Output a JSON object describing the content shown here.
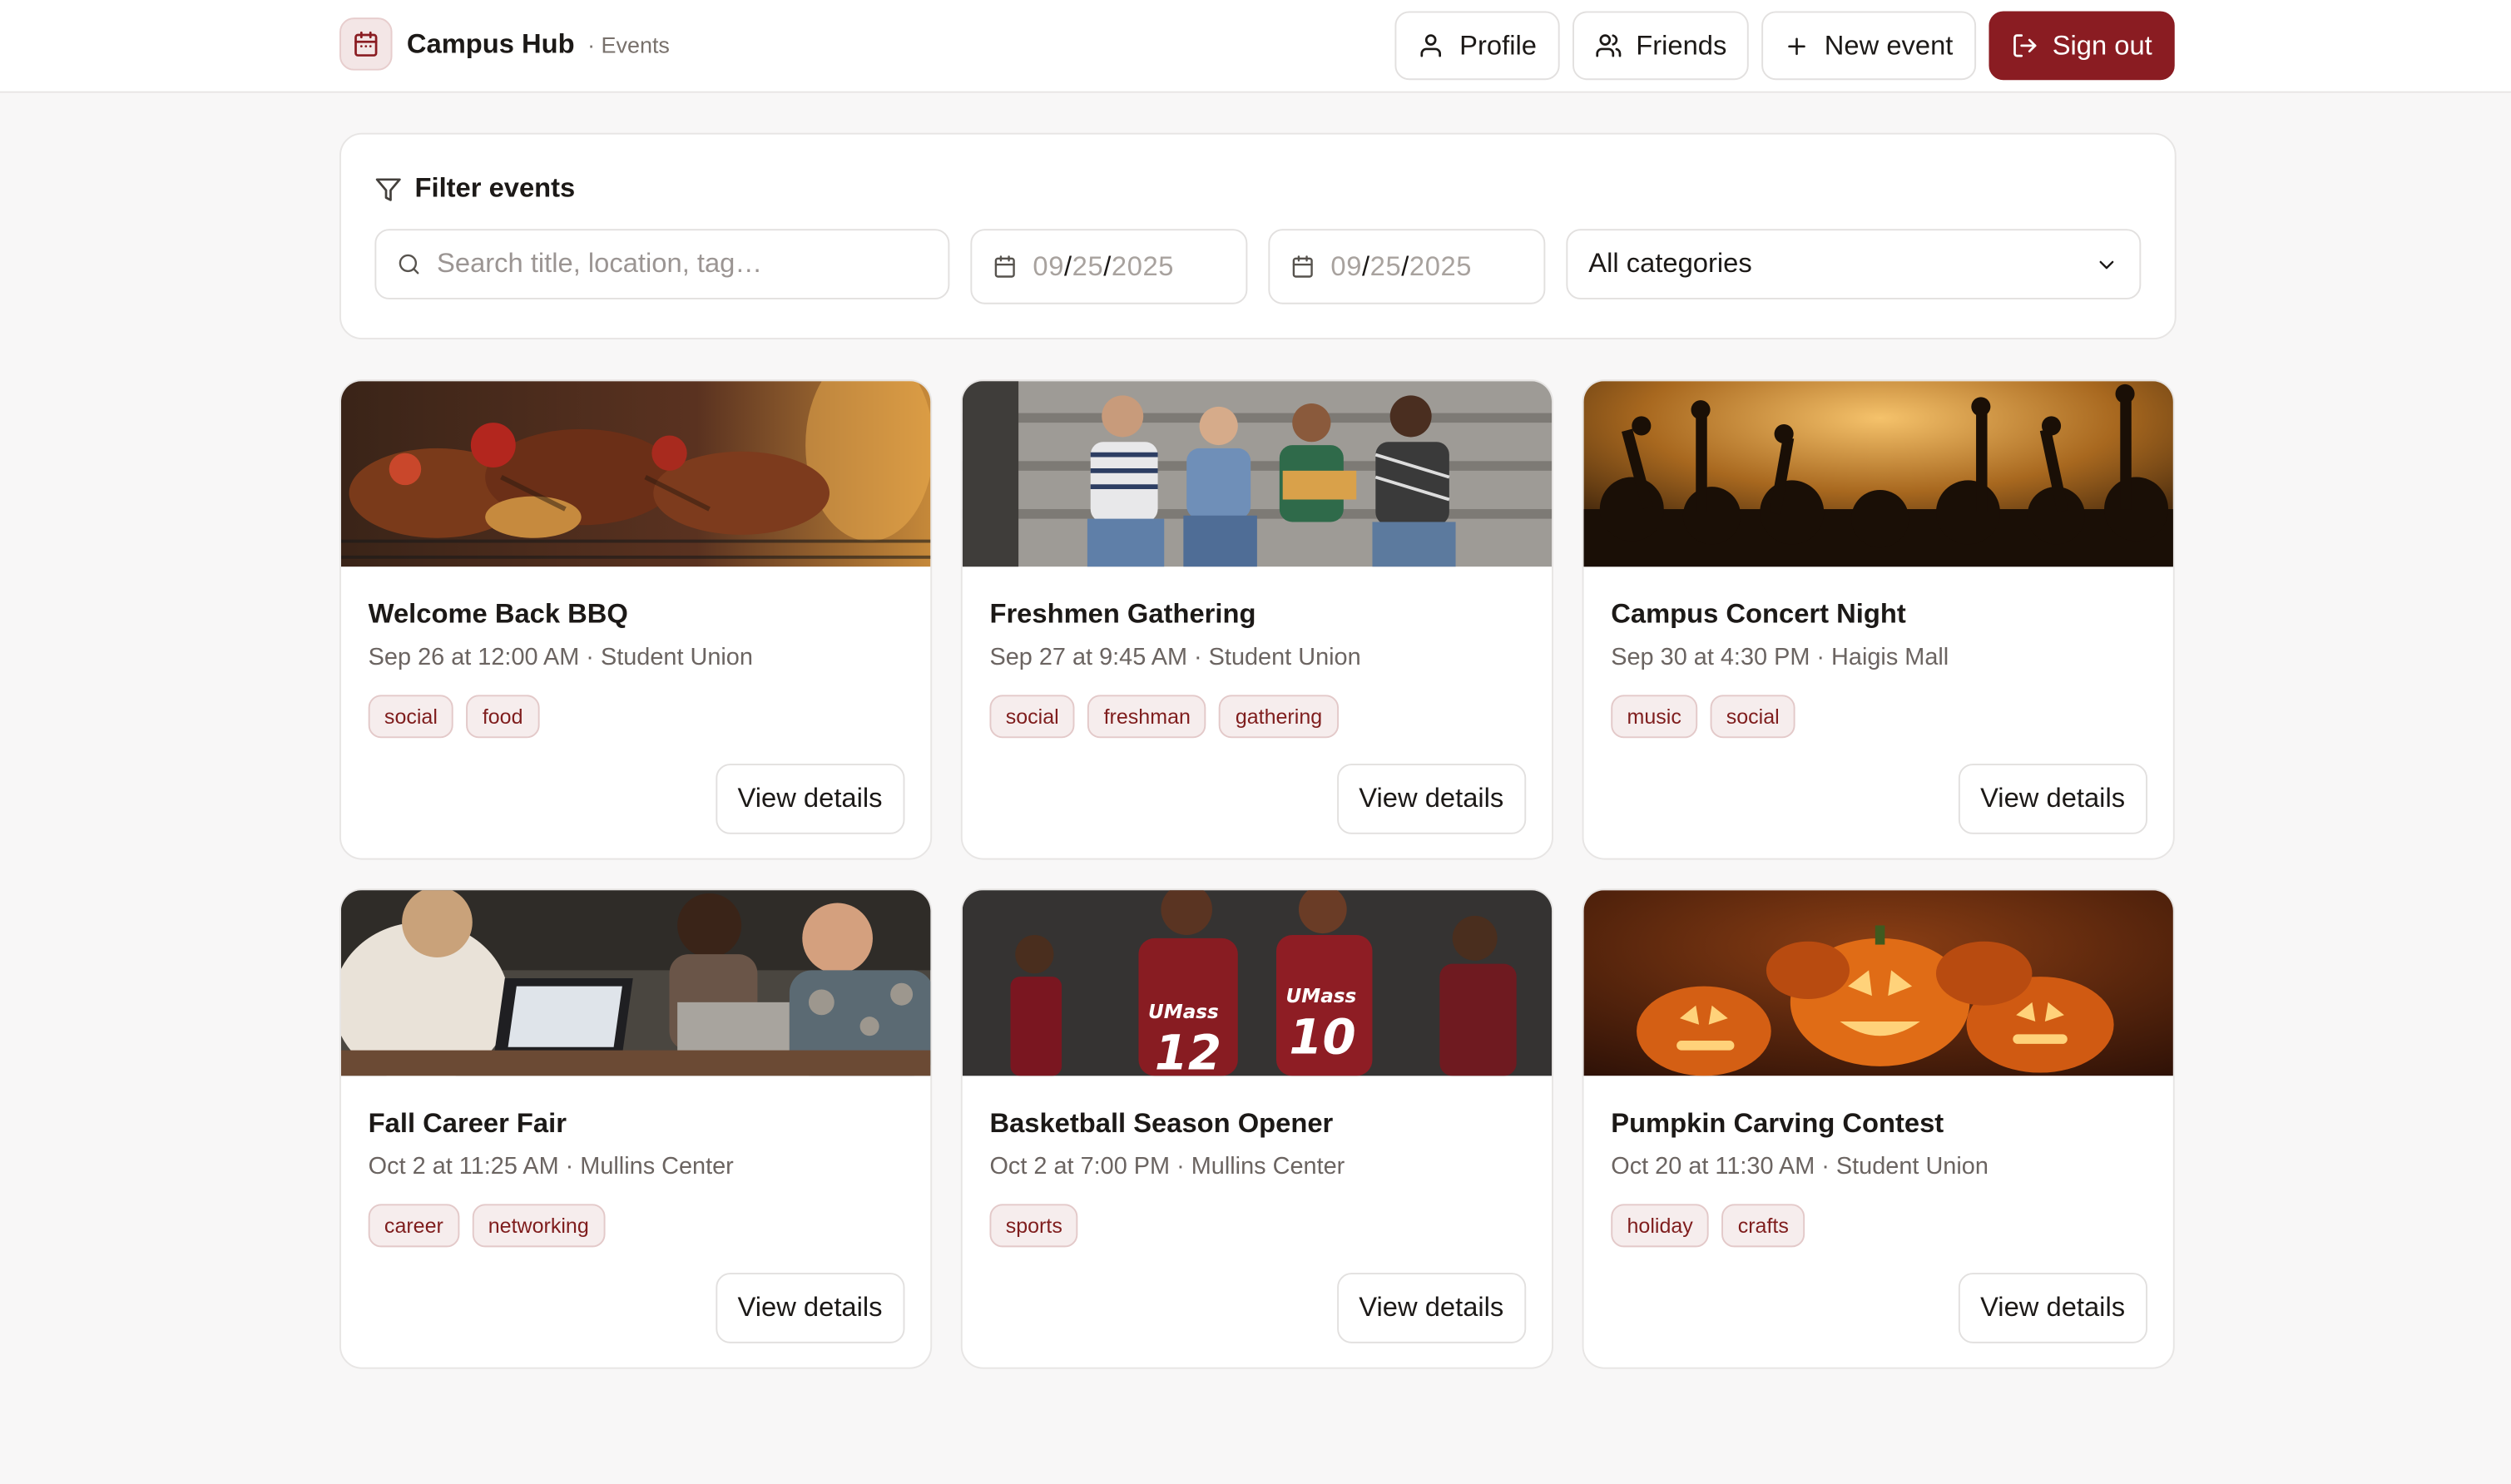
{
  "header": {
    "brand_title": "Campus Hub",
    "brand_sub": "· Events",
    "nav": {
      "profile": "Profile",
      "friends": "Friends",
      "new_event": "New event",
      "sign_out": "Sign out"
    }
  },
  "filter": {
    "title": "Filter events",
    "search_placeholder": "Search title, location, tag…",
    "start_date": {
      "mm": "09",
      "dd": "25",
      "yyyy": "2025"
    },
    "end_date": {
      "mm": "09",
      "dd": "25",
      "yyyy": "2025"
    },
    "category_selected": "All categories"
  },
  "events": [
    {
      "title": "Welcome Back BBQ",
      "meta": "Sep 26 at 12:00 AM · Student Union",
      "tags": [
        "social",
        "food"
      ],
      "button": "View details"
    },
    {
      "title": "Freshmen Gathering",
      "meta": "Sep 27 at 9:45 AM · Student Union",
      "tags": [
        "social",
        "freshman",
        "gathering"
      ],
      "button": "View details"
    },
    {
      "title": "Campus Concert Night",
      "meta": "Sep 30 at 4:30 PM · Haigis Mall",
      "tags": [
        "music",
        "social"
      ],
      "button": "View details"
    },
    {
      "title": "Fall Career Fair",
      "meta": "Oct 2 at 11:25 AM · Mullins Center",
      "tags": [
        "career",
        "networking"
      ],
      "button": "View details"
    },
    {
      "title": "Basketball Season Opener",
      "meta": "Oct 2 at 7:00 PM · Mullins Center",
      "tags": [
        "sports"
      ],
      "button": "View details"
    },
    {
      "title": "Pumpkin Carving Contest",
      "meta": "Oct 20 at 11:30 AM · Student Union",
      "tags": [
        "holiday",
        "crafts"
      ],
      "button": "View details"
    }
  ],
  "jersey_numbers": [
    "12",
    "10"
  ],
  "jersey_text": "UMass",
  "colors": {
    "accent": "#8a1c22",
    "tag_bg": "#f6eded",
    "tag_text": "#7f1d1d"
  }
}
